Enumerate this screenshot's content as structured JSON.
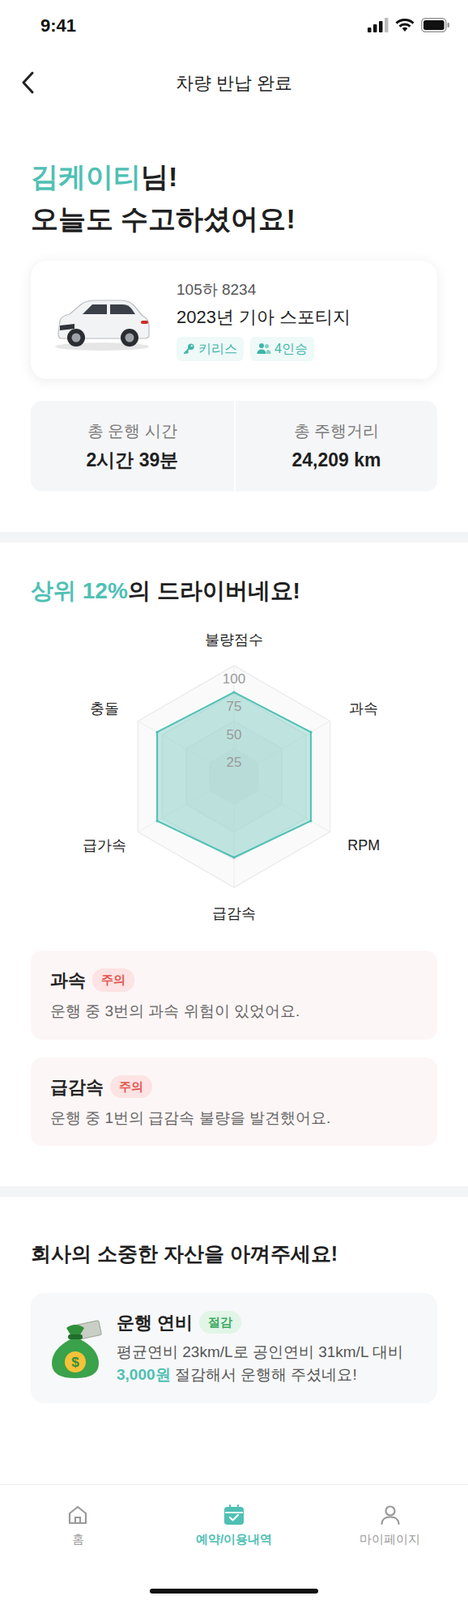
{
  "status_bar": {
    "time": "9:41"
  },
  "header": {
    "title": "차량 반납 완료"
  },
  "greeting": {
    "name": "김케이티",
    "suffix": "님!",
    "line2": "오늘도 수고하셨어요!"
  },
  "car": {
    "plate": "105하 8234",
    "model": "2023년 기아 스포티지",
    "tags": [
      {
        "label": "키리스",
        "kind": "key"
      },
      {
        "label": "4인승",
        "kind": "seats"
      }
    ]
  },
  "stats": [
    {
      "label": "총 운행 시간",
      "value": "2시간 39분"
    },
    {
      "label": "총 주행거리",
      "value": "24,209 km"
    }
  ],
  "ranking": {
    "highlight": "상위 12%",
    "rest": "의 드라이버네요!"
  },
  "chart": {
    "axes": [
      "불량점수",
      "과속",
      "RPM",
      "급감속",
      "급가속",
      "충돌"
    ],
    "ticks": [
      "100",
      "75",
      "50",
      "25"
    ],
    "series": [
      {
        "values": [
          76,
          80,
          80,
          73,
          80,
          80
        ]
      }
    ]
  },
  "alerts": [
    {
      "title": "과속",
      "badge": "주의",
      "message": "운행 중 3번의 과속 위험이 있었어요."
    },
    {
      "title": "급감속",
      "badge": "주의",
      "message": "운행 중 1번의 급감속 불량을 발견했어요."
    }
  ],
  "savings": {
    "heading": "회사의 소중한 자산을 아껴주세요!",
    "label": "운행 연비",
    "badge": "절감",
    "line1": "평균연비 23km/L로 공인연비 31km/L 대비",
    "amount": "3,000원",
    "line2": " 절감해서 운행해 주셨네요!"
  },
  "nav": [
    {
      "label": "홈",
      "selected": false,
      "kind": "home"
    },
    {
      "label": "예약/이용내역",
      "selected": true,
      "kind": "calendar"
    },
    {
      "label": "마이페이지",
      "selected": false,
      "kind": "person"
    }
  ]
}
